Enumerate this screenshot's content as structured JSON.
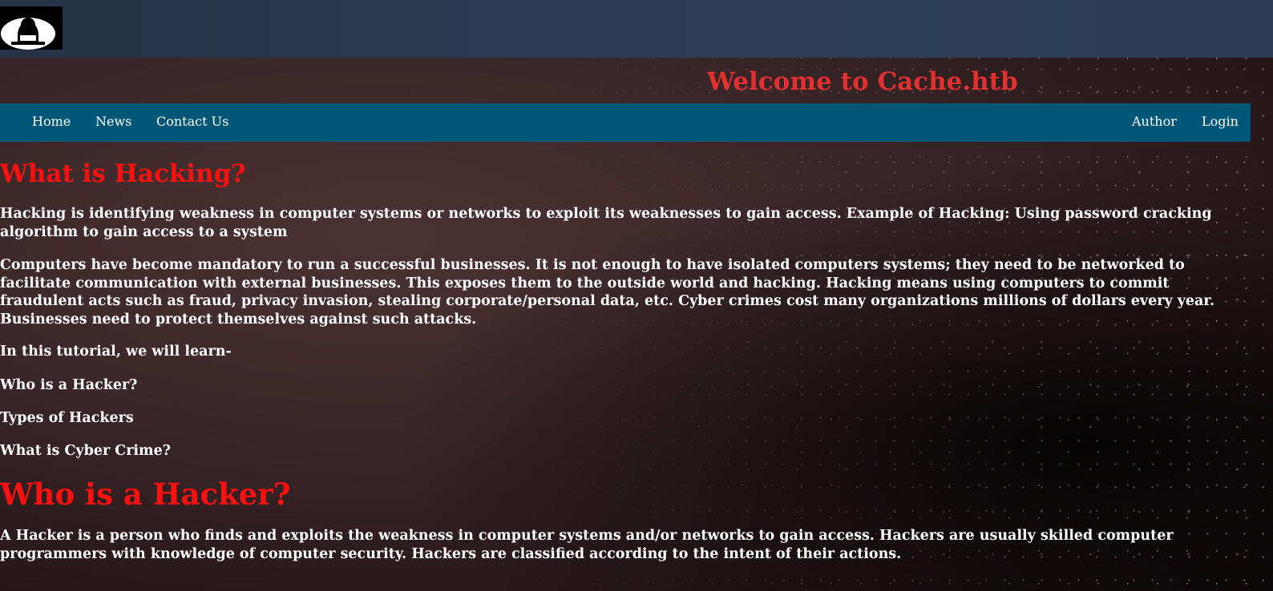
{
  "header": {
    "logo_icon": "hacker-silhouette-icon",
    "welcome": "Welcome to Cache.htb"
  },
  "nav": {
    "left": [
      "Home",
      "News",
      "Contact Us"
    ],
    "right": [
      "Author",
      "Login"
    ]
  },
  "content": {
    "heading1": "What is Hacking?",
    "p1": "Hacking is identifying weakness in computer systems or networks to exploit its weaknesses to gain access. Example of Hacking: Using password cracking algorithm to gain access to a system",
    "p2": "Computers have become mandatory to run a successful businesses. It is not enough to have isolated computers systems; they need to be networked to facilitate communication with external businesses. This exposes them to the outside world and hacking. Hacking means using computers to commit fraudulent acts such as fraud, privacy invasion, stealing corporate/personal data, etc. Cyber crimes cost many organizations millions of dollars every year. Businesses need to protect themselves against such attacks.",
    "p3": "In this tutorial, we will learn-",
    "toc": [
      "Who is a Hacker?",
      "Types of Hackers",
      "What is Cyber Crime?"
    ],
    "heading2": "Who is a Hacker?",
    "p4": "A Hacker is a person who finds and exploits the weakness in computer systems and/or networks to gain access. Hackers are usually skilled computer programmers with knowledge of computer security. Hackers are classified according to the intent of their actions."
  },
  "colors": {
    "heading_red": "#ff1010",
    "welcome_red": "#e0312f",
    "navbar": "#005677",
    "topband": "#2b3a52"
  }
}
